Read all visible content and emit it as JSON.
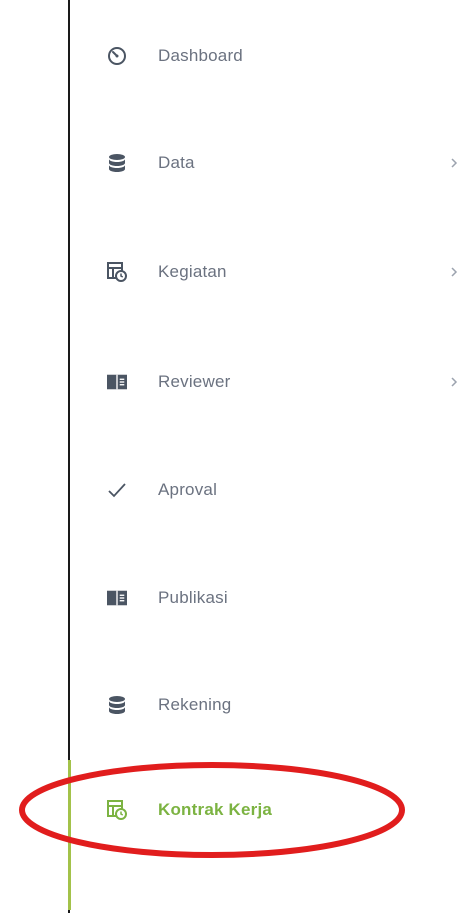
{
  "sidebar": {
    "items": [
      {
        "label": "Dashboard",
        "icon": "dashboard-gauge-icon",
        "has_submenu": false
      },
      {
        "label": "Data",
        "icon": "database-icon",
        "has_submenu": true
      },
      {
        "label": "Kegiatan",
        "icon": "calendar-clock-icon",
        "has_submenu": true
      },
      {
        "label": "Reviewer",
        "icon": "card-list-icon",
        "has_submenu": true
      },
      {
        "label": "Aproval",
        "icon": "check-icon",
        "has_submenu": false
      },
      {
        "label": "Publikasi",
        "icon": "card-list-icon",
        "has_submenu": false
      },
      {
        "label": "Rekening",
        "icon": "database-icon",
        "has_submenu": false
      },
      {
        "label": "Kontrak Kerja",
        "icon": "calendar-clock-icon",
        "has_submenu": false,
        "active": true
      }
    ]
  },
  "colors": {
    "text": "#6b7280",
    "icon": "#4b5563",
    "active": "#7cb342",
    "highlight": "#e11d1d"
  },
  "annotation": {
    "shape": "ellipse",
    "target": "Kontrak Kerja"
  }
}
